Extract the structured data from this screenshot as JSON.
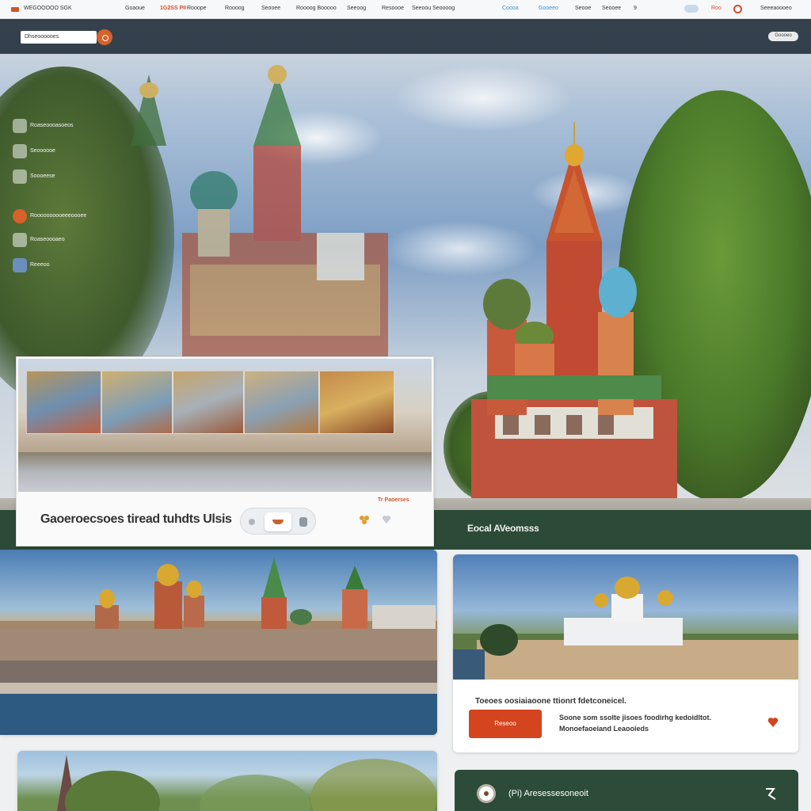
{
  "topnav": {
    "brand": "WEGOOOOO SGK",
    "links": [
      "Goaoue",
      "1G2SS PII",
      "Rooope",
      "Roooog",
      "Seooee",
      "Roooog Booooo",
      "Seeoog",
      "Resoooe",
      "Seeoou Seoooog",
      "Coooa",
      "Gooeeo",
      "Seooe",
      "Seooee",
      "9",
      "Roo",
      "Seeeaoooeo"
    ],
    "highlight": "#d84a2c"
  },
  "hero": {
    "search_value": "Dhseoooooes",
    "chip": "Goooeo",
    "footer_text": "Eocal AVeomsss"
  },
  "sidebar": {
    "items": [
      {
        "label": "Roaseoooasoeos",
        "icon": "building-icon"
      },
      {
        "label": "Seoooooe",
        "icon": "tower-icon"
      },
      {
        "label": "Soooeese",
        "icon": "camera-icon"
      },
      {
        "label": "Roooooooooeeeoooee",
        "icon": "pin-icon"
      },
      {
        "label": "Roaseoooaeo",
        "icon": "ticket-icon"
      },
      {
        "label": "Reeeoo",
        "icon": "info-icon"
      }
    ]
  },
  "gallery": {
    "title": "Gaoeroecsoes tiread tuhdts Ulsis",
    "tag": "Tr Paoerses"
  },
  "card_b": {
    "text": "Toeoes oosiaiaoone ttionrt fdetconeicel.",
    "button": "Reseoo",
    "desc_line1": "Soone som ssolte jisoes foodirhg kedoidltot.",
    "desc_line2": "Monoefaoeiand Leaooieds"
  },
  "card_d": {
    "label": "(Pi) Aresessesoneoit"
  },
  "colors": {
    "accent": "#d4441f",
    "dark_green": "#2c4b39",
    "navbar_bg": "#f7f8f9"
  }
}
